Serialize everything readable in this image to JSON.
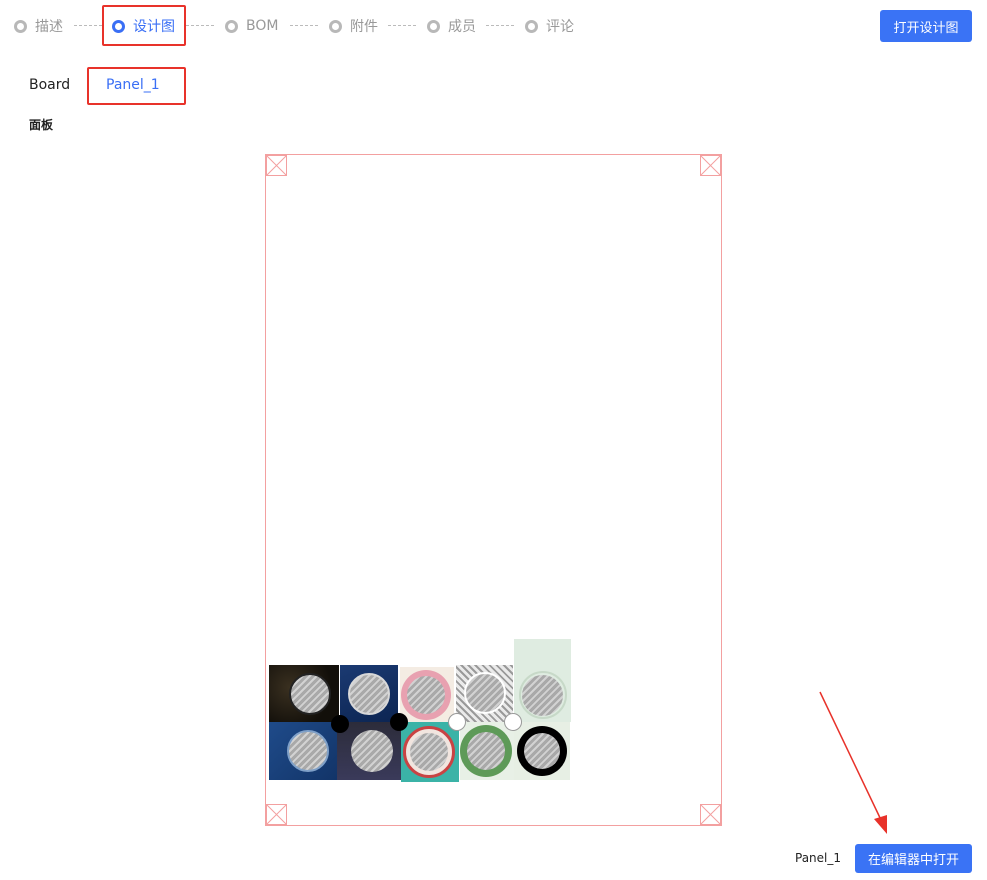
{
  "steps": [
    {
      "label": "描述",
      "active": false
    },
    {
      "label": "设计图",
      "active": true
    },
    {
      "label": "BOM",
      "active": false
    },
    {
      "label": "附件",
      "active": false
    },
    {
      "label": "成员",
      "active": false
    },
    {
      "label": "评论",
      "active": false
    }
  ],
  "header": {
    "open_design_button": "打开设计图"
  },
  "board": {
    "label": "Board",
    "tabs": [
      "Panel_1"
    ],
    "selected_tab": "Panel_1"
  },
  "section": {
    "title": "面板"
  },
  "footer": {
    "panel_name": "Panel_1",
    "open_in_editor_button": "在编辑器中打开"
  },
  "colors": {
    "accent": "#3a73f5",
    "highlight_red": "#e8322a",
    "canvas_border": "#f3a0a0"
  }
}
